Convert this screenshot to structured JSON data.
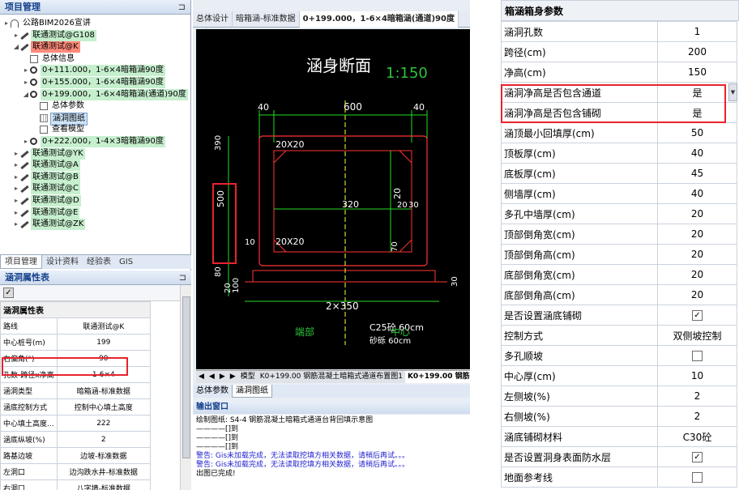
{
  "project_panel": {
    "title": "项目管理",
    "pin": "⊐",
    "tree": [
      {
        "label": "公路BIM2026宣讲",
        "icon": "arch-icon",
        "style": "plain"
      },
      {
        "label": "联通测试@G108",
        "icon": "culvert-icon",
        "style": "green"
      },
      {
        "label": "联通测试@K",
        "icon": "culvert-icon",
        "style": "red"
      },
      {
        "label": "总体信息",
        "icon": "list-icon",
        "style": "plain"
      },
      {
        "label": "0+111.000，1-6×4暗箱涵90度",
        "icon": "pin-icon",
        "style": "green"
      },
      {
        "label": "0+155.000，1-6×4暗箱涵90度",
        "icon": "pin-icon",
        "style": "green"
      },
      {
        "label": "0+199.000，1-6×4暗箱涵(通道)90度",
        "icon": "pin-icon",
        "style": "green"
      },
      {
        "label": "总体参数",
        "icon": "doc-icon",
        "style": "plain"
      },
      {
        "label": "涵洞图纸",
        "icon": "grid-icon",
        "style": "selected"
      },
      {
        "label": "查看模型",
        "icon": "model-icon",
        "style": "plain"
      },
      {
        "label": "0+222.000，1-4×3暗箱涵90度",
        "icon": "pin-icon",
        "style": "green"
      },
      {
        "label": "联通测试@YK",
        "icon": "culvert-icon",
        "style": "green"
      },
      {
        "label": "联通测试@A",
        "icon": "culvert-icon",
        "style": "green"
      },
      {
        "label": "联通测试@B",
        "icon": "culvert-icon",
        "style": "green"
      },
      {
        "label": "联通测试@C",
        "icon": "culvert-icon",
        "style": "green"
      },
      {
        "label": "联通测试@D",
        "icon": "culvert-icon",
        "style": "green"
      },
      {
        "label": "联通测试@E",
        "icon": "culvert-icon",
        "style": "green"
      },
      {
        "label": "联通测试@ZK",
        "icon": "culvert-icon",
        "style": "green"
      }
    ],
    "tabs": [
      "项目管理",
      "设计资料",
      "经验表",
      "GIS"
    ]
  },
  "attr_panel": {
    "title": "涵洞属性表",
    "pin": "⊐",
    "check_mark": "✓",
    "header": "涵洞属性表",
    "rows": [
      {
        "k": "路线",
        "v": "联通测试@K"
      },
      {
        "k": "中心桩号(m)",
        "v": "199"
      },
      {
        "k": "右偏角(°)",
        "v": "90"
      },
      {
        "k": "孔数-跨径x净高",
        "v": "1-6×4"
      },
      {
        "k": "涵洞类型",
        "v": "暗箱涵-标准数据"
      },
      {
        "k": "涵底控制方式",
        "v": "控制中心填土高度"
      },
      {
        "k": "中心填土高度...",
        "v": "222"
      },
      {
        "k": "涵底纵坡(%)",
        "v": "2"
      },
      {
        "k": "路基边坡",
        "v": "边坡-标准数据"
      },
      {
        "k": "左洞口",
        "v": "边沟跌水井-标准数据"
      },
      {
        "k": "右洞口",
        "v": "八字墙-标准数据"
      },
      {
        "k": "其它经验数据",
        "v": "无,无,一字墙-标准数据,..."
      }
    ]
  },
  "doc_tabs": [
    "总体设计",
    "暗箱涵-标准数据",
    "0+199.000，1-6×4暗箱涵(通道)90度",
    "×"
  ],
  "drawing": {
    "title": "涵身断面",
    "scale": "1:150",
    "dims": [
      "40",
      "600",
      "40",
      "20X20",
      "390",
      "500",
      "320",
      "20",
      "30",
      "10",
      "20X20",
      "70",
      "80",
      "20",
      "100",
      "30",
      "2×350",
      "C25砼 60cm",
      "砂砾 60cm",
      "端部",
      "中心"
    ]
  },
  "sheet_tabs": [
    "◀",
    "◀",
    "▶",
    "▶",
    "模型",
    "K0+199.00 钢筋混凝土暗箱式通道布置图1",
    "K0+199.00 钢筋混凝"
  ],
  "bottom_tabs": [
    "总体参数",
    "涵洞图纸"
  ],
  "output": {
    "title": "输出窗口",
    "lines": [
      {
        "t": "绘制图纸: S4-4 钢筋混凝土暗箱式通道台背回填示意图",
        "type": "normal"
      },
      {
        "t": "————[]到",
        "type": "normal"
      },
      {
        "t": "————[]到",
        "type": "normal"
      },
      {
        "t": "————[]到",
        "type": "normal"
      },
      {
        "t": "警告: Gis未加载完成，无法读取挖填方相关数据，请稍后再试。。。",
        "type": "warn"
      },
      {
        "t": "警告: Gis未加载完成，无法读取挖填方相关数据，请稍后再试。。。",
        "type": "warn"
      },
      {
        "t": "出图已完成!",
        "type": "normal"
      }
    ]
  },
  "box_params": {
    "title": "箱涵箱身参数",
    "rows": [
      {
        "k": "涵洞孔数",
        "v": "1"
      },
      {
        "k": "跨径(cm)",
        "v": "200"
      },
      {
        "k": "净高(cm)",
        "v": "150"
      },
      {
        "k": "涵洞净高是否包含通道",
        "v": "是"
      },
      {
        "k": "涵洞净高是否包含铺砌",
        "v": "是"
      },
      {
        "k": "涵顶最小回填厚(cm)",
        "v": "50"
      },
      {
        "k": "顶板厚(cm)",
        "v": "40"
      },
      {
        "k": "底板厚(cm)",
        "v": "45"
      },
      {
        "k": "侧墙厚(cm)",
        "v": "40"
      },
      {
        "k": "多孔中墙厚(cm)",
        "v": "20"
      },
      {
        "k": "顶部倒角宽(cm)",
        "v": "20"
      },
      {
        "k": "顶部倒角高(cm)",
        "v": "20"
      },
      {
        "k": "底部倒角宽(cm)",
        "v": "20"
      },
      {
        "k": "底部倒角高(cm)",
        "v": "20"
      },
      {
        "k": "是否设置涵底铺砌",
        "v": "✓",
        "checkbox": true
      },
      {
        "k": "控制方式",
        "v": "双侧坡控制"
      },
      {
        "k": "多孔顺坡",
        "v": "",
        "checkbox": true
      },
      {
        "k": "中心厚(cm)",
        "v": "10"
      },
      {
        "k": "左侧坡(%)",
        "v": "2"
      },
      {
        "k": "右侧坡(%)",
        "v": "2"
      },
      {
        "k": "涵底铺砌材料",
        "v": "C30砼"
      },
      {
        "k": "是否设置洞身表面防水层",
        "v": "✓",
        "checkbox": true
      },
      {
        "k": "地面参考线",
        "v": "",
        "checkbox": true
      }
    ],
    "dropdown_glyph": "▼"
  }
}
